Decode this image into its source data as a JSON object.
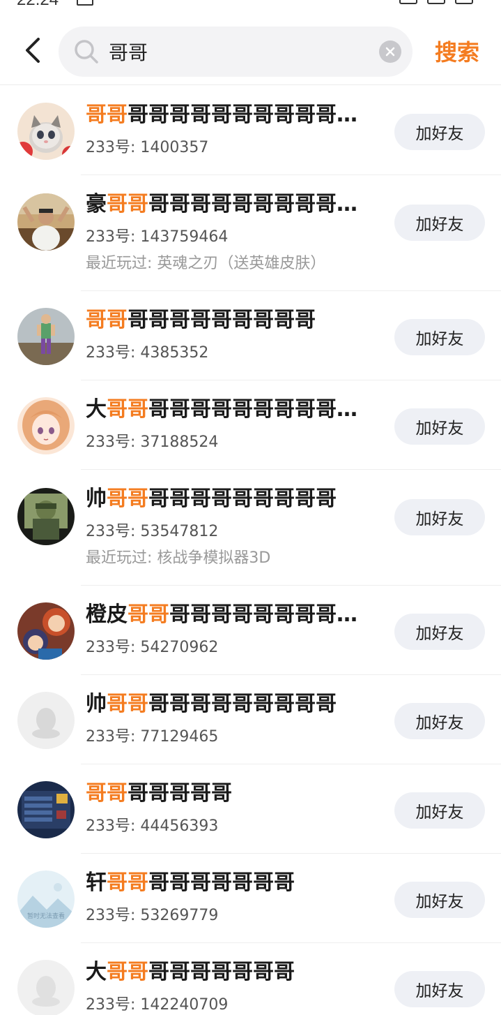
{
  "status_bar": {
    "time": "22:24"
  },
  "header": {
    "search_value": "哥哥",
    "search_button": "搜索"
  },
  "results": [
    {
      "name_prefix": "",
      "name_highlight": "哥哥",
      "name_suffix": "哥哥哥哥哥哥哥哥哥哥哥哥哥哥哥哥",
      "uid": "233号: 1400357",
      "played": "",
      "button": "加好友",
      "avatar": "kitten"
    },
    {
      "name_prefix": "豪",
      "name_highlight": "哥哥",
      "name_suffix": "哥哥哥哥哥哥哥哥哥哥哥哥哥哥",
      "uid": "233号: 143759464",
      "played": "最近玩过: 英魂之刃（送英雄皮肤）",
      "button": "加好友",
      "avatar": "man-room"
    },
    {
      "name_prefix": "",
      "name_highlight": "哥哥",
      "name_suffix": "哥哥哥哥哥哥哥哥哥",
      "uid": "233号: 4385352",
      "played": "",
      "button": "加好友",
      "avatar": "game-character"
    },
    {
      "name_prefix": "大",
      "name_highlight": "哥哥",
      "name_suffix": "哥哥哥哥哥哥哥哥哥哥哥哥哥哥",
      "uid": "233号: 37188524",
      "played": "",
      "button": "加好友",
      "avatar": "anime-girl"
    },
    {
      "name_prefix": "帅",
      "name_highlight": "哥哥",
      "name_suffix": "哥哥哥哥哥哥哥哥哥",
      "uid": "233号: 53547812",
      "played": "最近玩过: 核战争模拟器3D",
      "button": "加好友",
      "avatar": "photo-person"
    },
    {
      "name_prefix": "橙皮",
      "name_highlight": "哥哥",
      "name_suffix": "哥哥哥哥哥哥哥哥哥哥哥哥哥",
      "uid": "233号: 54270962",
      "played": "",
      "button": "加好友",
      "avatar": "cartoon"
    },
    {
      "name_prefix": "帅",
      "name_highlight": "哥哥",
      "name_suffix": "哥哥哥哥哥哥哥哥哥",
      "uid": "233号: 77129465",
      "played": "",
      "button": "加好友",
      "avatar": "default"
    },
    {
      "name_prefix": "",
      "name_highlight": "哥哥",
      "name_suffix": "哥哥哥哥哥",
      "uid": "233号: 44456393",
      "played": "",
      "button": "加好友",
      "avatar": "game-screen"
    },
    {
      "name_prefix": "轩",
      "name_highlight": "哥哥",
      "name_suffix": "哥哥哥哥哥哥哥",
      "uid": "233号: 53269779",
      "played": "",
      "button": "加好友",
      "avatar": "placeholder"
    },
    {
      "name_prefix": "大",
      "name_highlight": "哥哥",
      "name_suffix": "哥哥哥哥哥哥哥",
      "uid": "233号: 142240709",
      "played": "",
      "button": "加好友",
      "avatar": "default-blur"
    }
  ],
  "placeholder_avatar_text": "暂时无法查看",
  "colors": {
    "accent": "#f47c20",
    "button_bg": "#eef0f5",
    "divider": "#eeeeee"
  }
}
